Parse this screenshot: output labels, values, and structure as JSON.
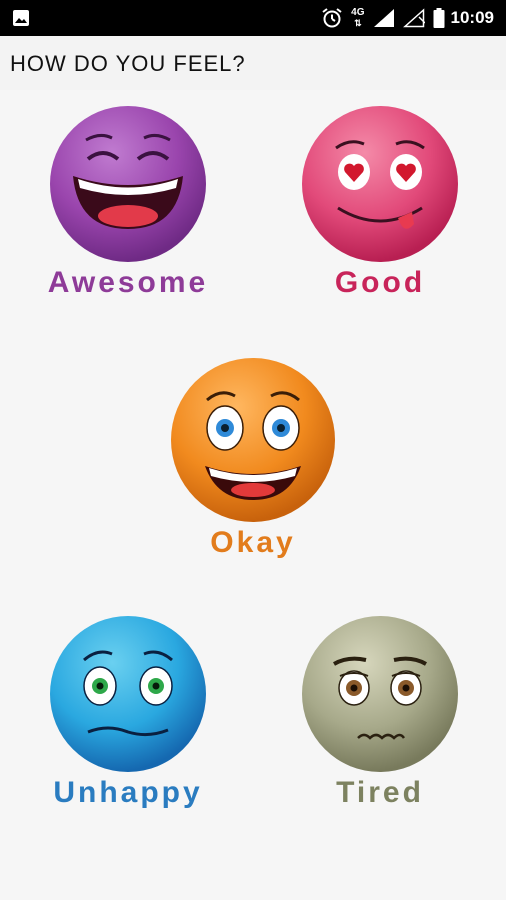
{
  "status_bar": {
    "time": "10:09",
    "network": "4G",
    "icons": [
      "image-icon",
      "alarm-icon",
      "signal-icon",
      "signal-empty-icon",
      "battery-icon"
    ]
  },
  "header": {
    "title": "HOW DO YOU FEEL?"
  },
  "moods": [
    {
      "label": "Awesome",
      "color": "#8e3b98",
      "face_color": "#9a45ad"
    },
    {
      "label": "Good",
      "color": "#c8245a",
      "face_color": "#e24a7a"
    },
    {
      "label": "Okay",
      "color": "#e27c1c",
      "face_color": "#f18a1e"
    },
    {
      "label": "Unhappy",
      "color": "#2a7cc0",
      "face_color": "#2aa8e0"
    },
    {
      "label": "Tired",
      "color": "#7d8260",
      "face_color": "#a7a98a"
    }
  ]
}
